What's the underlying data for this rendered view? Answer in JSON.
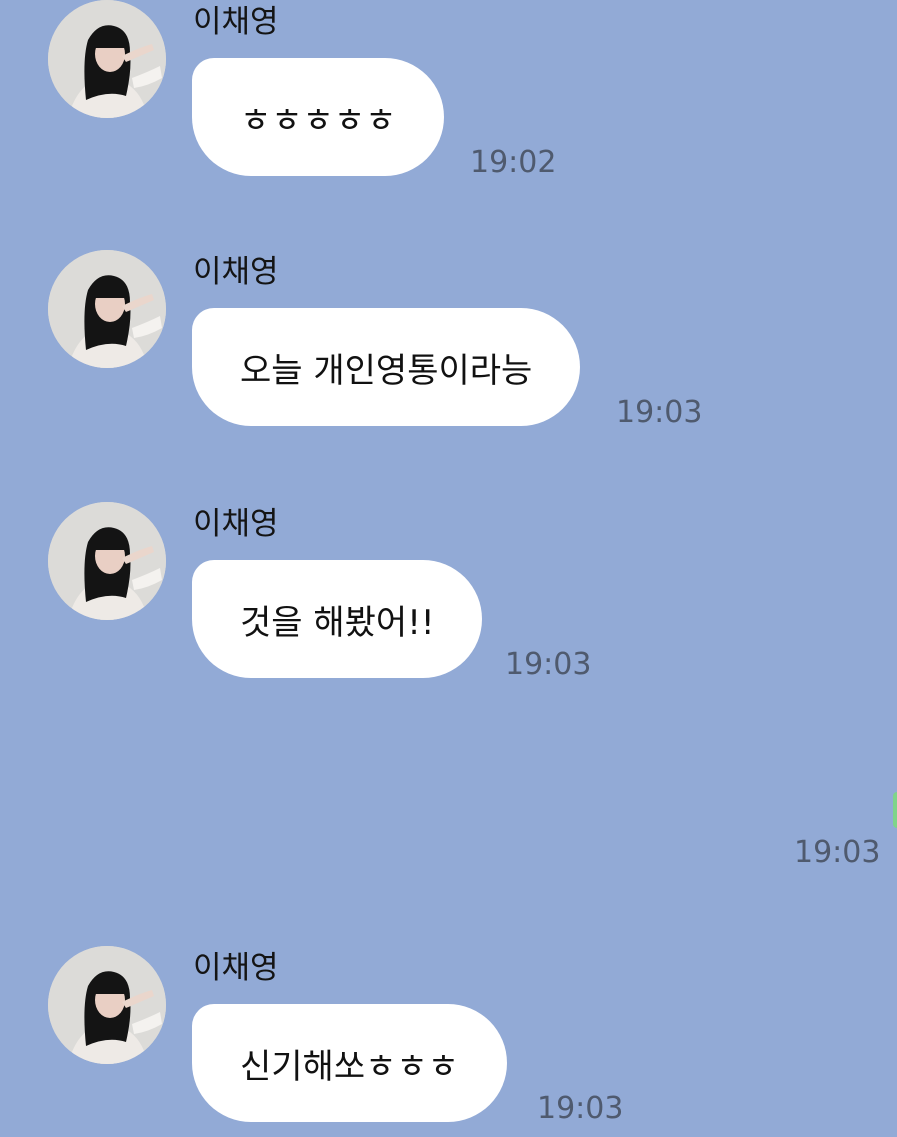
{
  "chat": {
    "messages": [
      {
        "sender": "이채영",
        "text": "ㅎㅎㅎㅎㅎ",
        "time": "19:02"
      },
      {
        "sender": "이채영",
        "text": "오늘 개인영통이라능",
        "time": "19:03"
      },
      {
        "sender": "이채영",
        "text": "것을 해봤어!!",
        "time": "19:03"
      },
      {
        "sender": "이채영",
        "text": "신기해쏘ㅎㅎㅎ",
        "time": "19:03"
      }
    ],
    "own_message_time": "19:03"
  },
  "colors": {
    "background": "#92aad6",
    "bubble": "#ffffff",
    "timestamp": "#4f5a6e"
  }
}
